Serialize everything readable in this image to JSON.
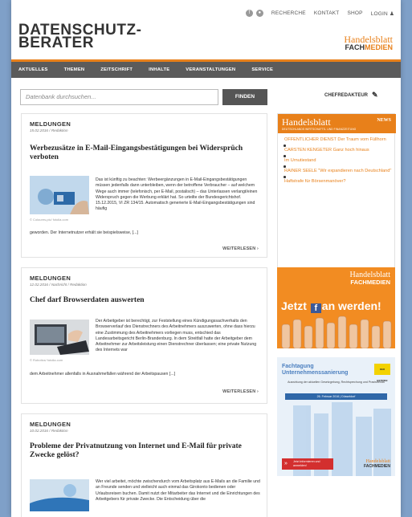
{
  "util": {
    "recherche": "RECHERCHE",
    "kontakt": "KONTAKT",
    "shop": "SHOP",
    "login": "LOGIN"
  },
  "logo": {
    "line1": "DATENSCHUTZ-",
    "line2": "BERATER"
  },
  "brand": {
    "handelsblatt": "Handelsblatt",
    "fach": "FACH",
    "medien": "MEDIEN"
  },
  "nav": [
    "AKTUELLES",
    "THEMEN",
    "ZEITSCHRIFT",
    "INHALTE",
    "VERANSTALTUNGEN",
    "SERVICE"
  ],
  "search": {
    "placeholder": "Datenbank durchsuchen...",
    "button": "FINDEN",
    "chef": "CHEFREDAKTEUR"
  },
  "articles": [
    {
      "category": "MELDUNGEN",
      "meta": "15.02.2016 / Redaktion",
      "title": "Werbezusätze in E-Mail-Eingangsbestätigungen bei Widersprüch verboten",
      "credit": "© Coloures-pic/ fotolia.com",
      "body_side": "Das ist künftig zu beachten: Werbeergänzungen in E-Mail-Eingangsbestätigungen müssen jedenfalls dann unterbleiben, wenn der betroffene Verbraucher – auf welchem Wege auch immer (telefonisch, per E-Mail, postalisch) – das Unterlassen verlangt/einen Widerspruch gegen die Werbung erklärt hat. So urteilte der Bundesgerichtshof. 15.12.2015, VI ZR 134/15. Automatisch generierte E-Mail-Eingangsbestätigungen sind häufig",
      "body_full": "geworden. Der Internetnutzer erhält sie beispielsweise, [...]",
      "more": "WEITERLESEN"
    },
    {
      "category": "MELDUNGEN",
      "meta": "12.02.2016 / Nachricht / Redaktion",
      "title": "Chef darf Browserdaten auswerten",
      "credit": "© Robotics/ fotolia.com",
      "body_side": "Der Arbeitgeber ist berechtigt, zur Feststellung eines Kündigungssachverhalts den Browserverlauf des Dienstrechners des Arbeitnehmers auszuwerten, ohne dass hierzu eine Zustimmung des Arbeitnehmers vorliegen muss, entschied das Landesarbeitsgericht Berlin-Brandenburg. In dem Streitfall hatte der Arbeitgeber dem Arbeitnehmer zur Arbeitsleistung einen Dienstrechner überlassen; eine private Nutzung des Internets war",
      "body_full": "dem Arbeitnehmer allenfalls in Ausnahmefällen während der Arbeitspausen [...]",
      "more": "WEITERLESEN"
    },
    {
      "category": "MELDUNGEN",
      "meta": "10.02.2016 / Redaktion",
      "title": "Probleme der Privatnutzung von Internet und E-Mail für private Zwecke gelöst?",
      "body_side": "Wer viel arbeitet, möchte zwischendurch vom Arbeitsplatz aus E-Mails an die Familie und an Freunde senden und vielleicht auch einmal das Girokonto bedienen oder Urlaubsreisen buchen. Damit nutzt der Mitarbeiter das Internet und die Einrichtungen des Arbeitgebers für private Zwecke. Die Entscheidung über die"
    }
  ],
  "news": {
    "title": "Handelsblatt",
    "tag": "NEWS",
    "sub": "DEUTSCHLANDS WIRTSCHAFTS- UND FINANZZEITUNG",
    "links": [
      "OFFENTLICHER DIENST Der Traum vom Füllhorn",
      "CARSTEN KENGETER Ganz hoch hinaus",
      "Im Urnutiestand",
      "RAINER SEELE \"Wir expandieren nach Deutschland\"",
      "Haftstrafe für Börsenmanöver?"
    ]
  },
  "fb_ad": {
    "hb": "Handelsblatt",
    "fm": "FACHMEDIEN",
    "slogan_pre": "Jetzt ",
    "f": "f",
    "slogan_post": "an werden!"
  },
  "ft_ad": {
    "title1": "Fachtagung",
    "title2": "Unternehmenssanierung",
    "logo": "DER BETRIEB",
    "sub": "Auswirkung der aktuellen Gesetzgebung, Rechtsprechung und Praxistrends",
    "date": "26. Februar 2016 | Düsseldorf",
    "cta": "Jetzt informieren und anmelden!",
    "hb": "Handelsblatt",
    "fm": "FACHMEDIEN"
  }
}
